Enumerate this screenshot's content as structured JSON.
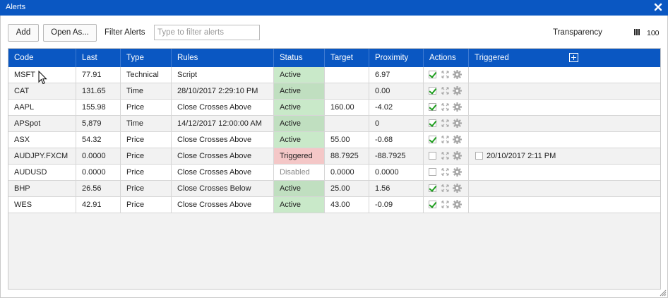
{
  "window": {
    "title": "Alerts"
  },
  "toolbar": {
    "add_label": "Add",
    "open_as_label": "Open As...",
    "filter_label": "Filter Alerts",
    "filter_placeholder": "Type to filter alerts",
    "filter_value": "",
    "transparency_label": "Transparency",
    "transparency_value": "100"
  },
  "table": {
    "columns": [
      "Code",
      "Last",
      "Type",
      "Rules",
      "Status",
      "Target",
      "Proximity",
      "Actions",
      "Triggered"
    ],
    "rows": [
      {
        "code": "MSFT",
        "last": "77.91",
        "type": "Technical",
        "rules": "Script",
        "status": "Active",
        "target": "",
        "proximity": "6.97",
        "enabled": true,
        "triggered": ""
      },
      {
        "code": "CAT",
        "last": "131.65",
        "type": "Time",
        "rules": "28/10/2017 2:29:10 PM",
        "status": "Active",
        "target": "",
        "proximity": "0.00",
        "enabled": true,
        "triggered": ""
      },
      {
        "code": "AAPL",
        "last": "155.98",
        "type": "Price",
        "rules": "Close Crosses Above",
        "status": "Active",
        "target": "160.00",
        "proximity": "-4.02",
        "enabled": true,
        "triggered": ""
      },
      {
        "code": "APSpot",
        "last": "5,879",
        "type": "Time",
        "rules": "14/12/2017 12:00:00 AM",
        "status": "Active",
        "target": "",
        "proximity": "0",
        "enabled": true,
        "triggered": ""
      },
      {
        "code": "ASX",
        "last": "54.32",
        "type": "Price",
        "rules": "Close Crosses Above",
        "status": "Active",
        "target": "55.00",
        "proximity": "-0.68",
        "enabled": true,
        "triggered": ""
      },
      {
        "code": "AUDJPY.FXCM",
        "last": "0.0000",
        "type": "Price",
        "rules": "Close Crosses Above",
        "status": "Triggered",
        "target": "88.7925",
        "proximity": "-88.7925",
        "enabled": false,
        "triggered": "20/10/2017 2:11 PM"
      },
      {
        "code": "AUDUSD",
        "last": "0.0000",
        "type": "Price",
        "rules": "Close Crosses Above",
        "status": "Disabled",
        "target": "0.0000",
        "proximity": "0.0000",
        "enabled": false,
        "triggered": ""
      },
      {
        "code": "BHP",
        "last": "26.56",
        "type": "Price",
        "rules": "Close Crosses Below",
        "status": "Active",
        "target": "25.00",
        "proximity": "1.56",
        "enabled": true,
        "triggered": ""
      },
      {
        "code": "WES",
        "last": "42.91",
        "type": "Price",
        "rules": "Close Crosses Above",
        "status": "Active",
        "target": "43.00",
        "proximity": "-0.09",
        "enabled": true,
        "triggered": ""
      }
    ]
  },
  "colors": {
    "header_bg": "#0a57c2",
    "active_status": "#c9e9c9",
    "triggered_status": "#f4c7c7",
    "disabled_text": "#888888",
    "check_green": "#1f9e1f"
  },
  "icons": [
    "close-icon",
    "transparency-icon",
    "add-column-icon",
    "checkbox-icon",
    "expand-icon",
    "gear-icon",
    "cursor-icon",
    "resize-grip-icon"
  ]
}
